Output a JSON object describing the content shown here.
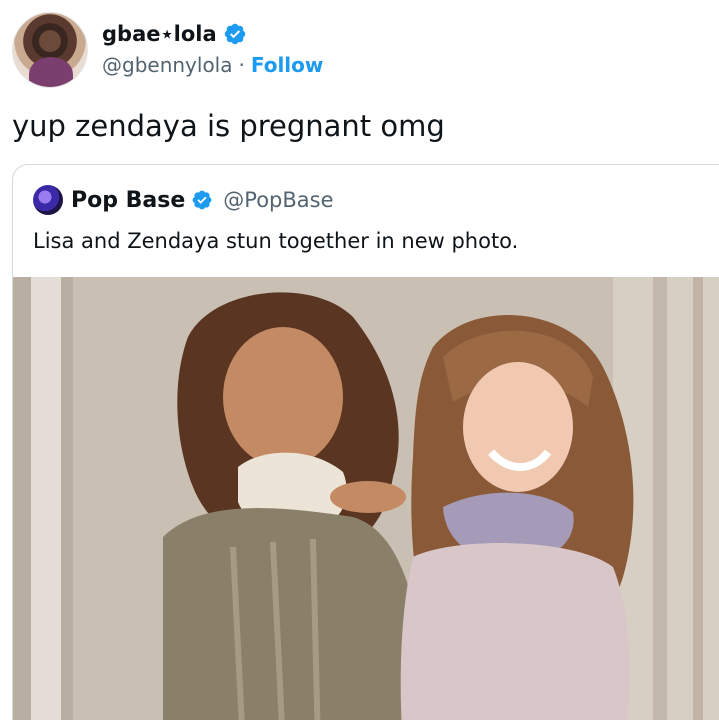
{
  "tweet": {
    "display_name": "gbae⋆lola",
    "handle": "@gbennylola",
    "separator": "·",
    "follow_label": "Follow",
    "text": "yup zendaya is pregnant omg"
  },
  "quoted": {
    "display_name": "Pop Base",
    "handle": "@PopBase",
    "text": "Lisa and Zendaya stun together in new photo."
  },
  "colors": {
    "accent": "#1d9bf0",
    "secondary_text": "#536471",
    "border": "#cfd9de"
  },
  "icons": {
    "verified": "verified-badge-icon"
  }
}
